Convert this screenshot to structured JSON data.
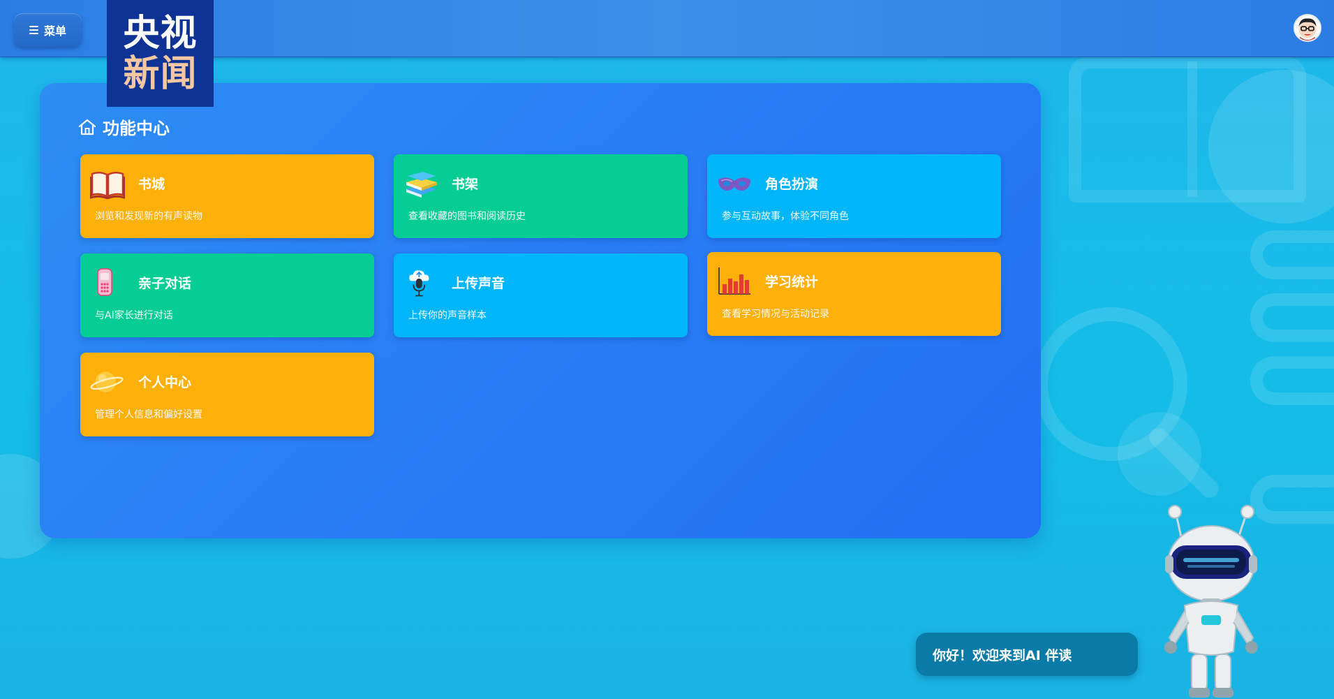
{
  "header": {
    "menu_label": "菜单",
    "logo_line1": "央视",
    "logo_line2": "新闻"
  },
  "panel": {
    "title": "功能中心",
    "cards": [
      {
        "title": "书城",
        "desc": "浏览和发现新的有声读物",
        "color": "#fdb00a",
        "icon": "open-book-icon"
      },
      {
        "title": "书架",
        "desc": "查看收藏的图书和阅读历史",
        "color": "#06cd94",
        "icon": "book-stack-icon"
      },
      {
        "title": "角色扮演",
        "desc": "参与互动故事，体验不同角色",
        "color": "#00b5f8",
        "icon": "mask-icon"
      },
      {
        "title": "亲子对话",
        "desc": "与AI家长进行对话",
        "color": "#06cd94",
        "icon": "phone-icon"
      },
      {
        "title": "上传声音",
        "desc": "上传你的声音样本",
        "color": "#00b5f8",
        "icon": "cloud-mic-icon"
      },
      {
        "title": "学习统计",
        "desc": "查看学习情况与活动记录",
        "color": "#fdb00a",
        "icon": "bar-chart-icon"
      },
      {
        "title": "个人中心",
        "desc": "管理个人信息和偏好设置",
        "color": "#fdb00a",
        "icon": "planet-icon"
      }
    ]
  },
  "assistant": {
    "greeting": "你好！欢迎来到AI 伴读"
  }
}
